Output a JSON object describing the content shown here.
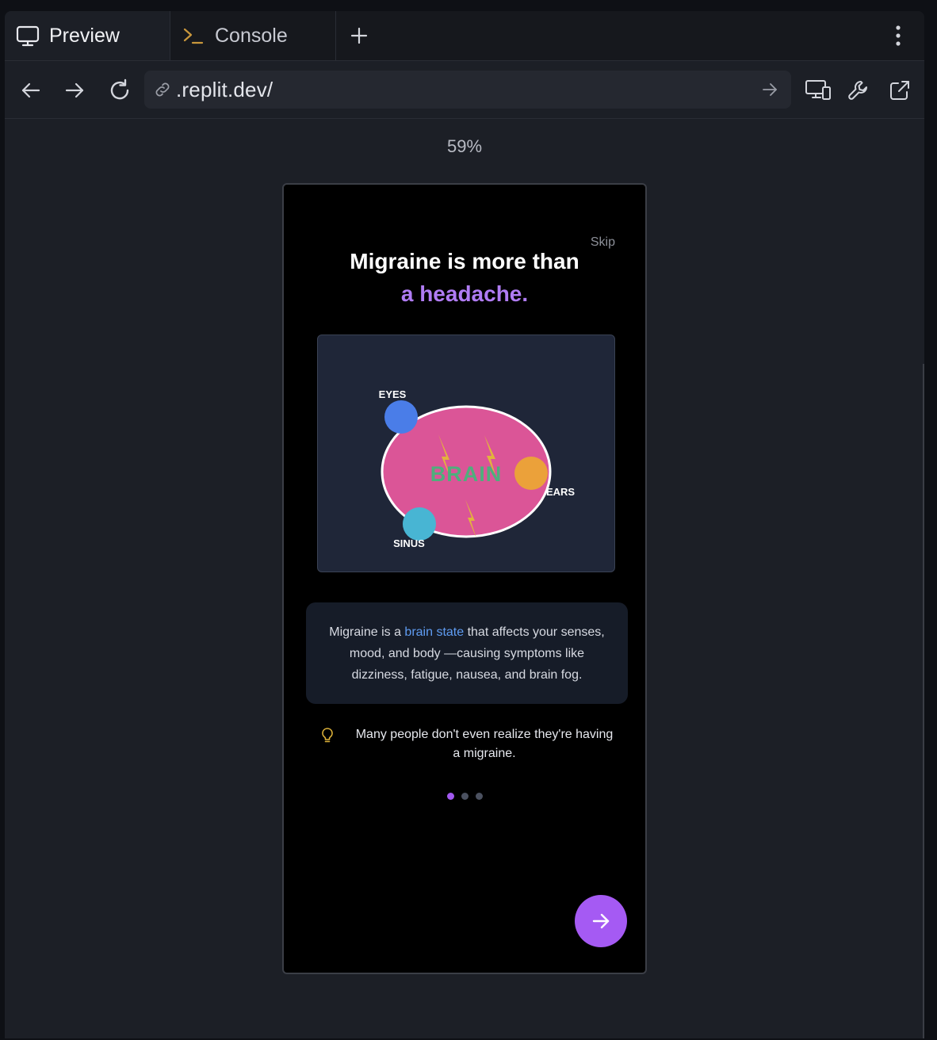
{
  "tabs": {
    "preview_label": "Preview",
    "console_label": "Console"
  },
  "browser": {
    "url": ".replit.dev/"
  },
  "preview": {
    "zoom": "59%"
  },
  "onboarding": {
    "skip_label": "Skip",
    "headline_line1": "Migraine is more than",
    "headline_accent": "a headache.",
    "illustration": {
      "brain_label": "BRAIN",
      "eyes_label": "EYES",
      "ears_label": "EARS",
      "sinus_label": "SINUS"
    },
    "info": {
      "before": "Migraine is a ",
      "highlight": "brain state",
      "after": " that affects your senses, mood, and body —causing symptoms like dizziness, fatigue, nausea, and brain fog."
    },
    "tip_text": "Many people don't even realize they're having a migraine.",
    "pagination": {
      "current": 1,
      "total": 3
    }
  },
  "colors": {
    "accent_purple": "#a55af3",
    "headline_accent": "#b07cf4",
    "link_blue": "#5f9cf2",
    "brain_pink": "#db5597",
    "brain_label_green": "#4fae7c",
    "eyes_blue": "#4a7de8",
    "ears_orange": "#eba13a",
    "sinus_cyan": "#48b5d3",
    "lightning_yellow": "#e2b33d"
  }
}
